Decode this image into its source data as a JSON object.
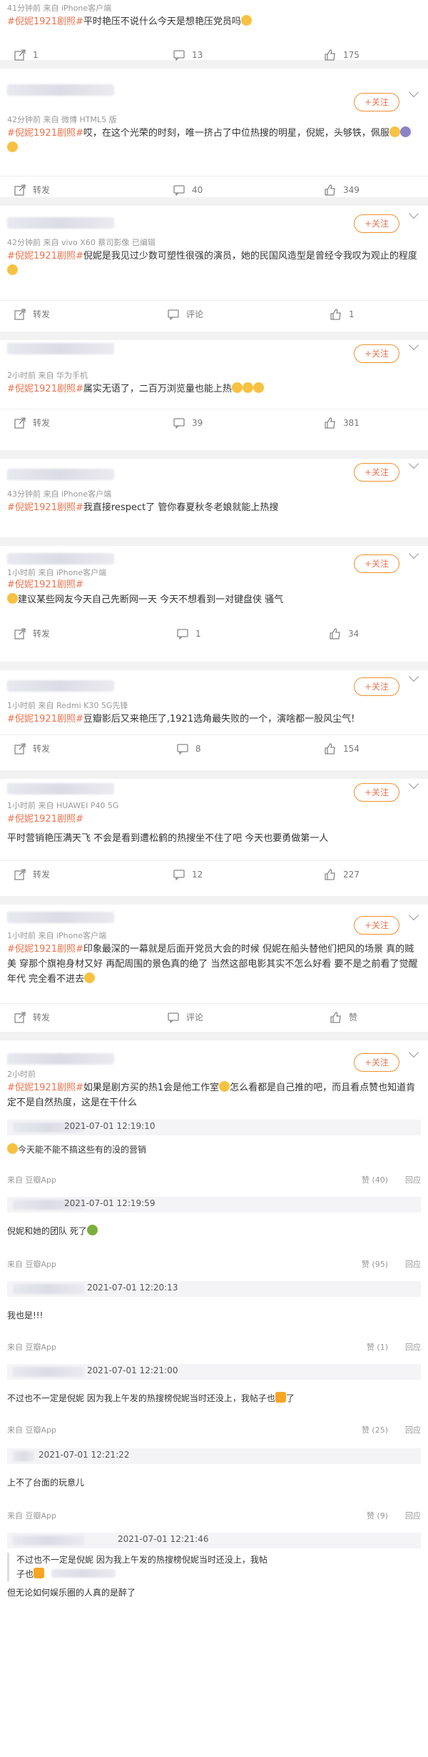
{
  "post1": {
    "meta": "41分钟前  来自 iPhone客户端",
    "tag": "#倪妮1921剧照#",
    "text": "平时艳压不说什么今天是想艳压党员吗",
    "repost": "1",
    "comments": "13",
    "likes": "175"
  },
  "post2": {
    "follow": "+关注",
    "meta": "42分钟前  来自 微博 HTML5 版",
    "tag": "#倪妮1921剧照#",
    "text": "哎，在这个光荣的时刻，唯一挤占了中位热搜的明星，倪妮，头够铁，佩服",
    "repost": "转发",
    "comments": "40",
    "likes": "349"
  },
  "post3": {
    "follow": "+关注",
    "meta": "42分钟前  来自 vivo X60 蔡司影像 已编辑",
    "tag": "#倪妮1921剧照#",
    "text": "倪妮是我见过少数可塑性很强的演员，她的民国风造型是曾经令我叹为观止的程度",
    "repost": "转发",
    "comments": "评论",
    "likes": "1"
  },
  "post4": {
    "follow": "+关注",
    "meta": "2小时前  来自 华为手机",
    "tag": "#倪妮1921剧照#",
    "text": "属实无语了，二百万浏览量也能上热",
    "repost": "转发",
    "comments": "39",
    "likes": "381"
  },
  "post5": {
    "follow": "+关注",
    "meta": "43分钟前  来自 iPhone客户端",
    "tag": "#倪妮1921剧照#",
    "text": "我直接respect了 管你春夏秋冬老娘就能上热搜"
  },
  "post6": {
    "follow": "+关注",
    "meta": "1小时前  来自 iPhone客户端",
    "tag": "#倪妮1921剧照#",
    "text": "建议某些网友今天自己先断网一天 今天不想看到一对键盘侠 骚气",
    "repost": "转发",
    "comments": "1",
    "likes": "34"
  },
  "post7": {
    "follow": "+关注",
    "meta": "1小时前  来自 Redmi K30 5G先锋",
    "tag": "#倪妮1921剧照#",
    "text": "豆瓣影后又来艳压了,1921选角最失败的一个，演啥都一股风尘气!",
    "repost": "转发",
    "comments": "8",
    "likes": "154"
  },
  "post8": {
    "follow": "+关注",
    "meta": "1小时前  来自 HUAWEI P40 5G",
    "tag": "#倪妮1921剧照#",
    "text": "平时营销艳压满天飞 不会是看到遭松鹤的热搜坐不住了吧 今天也要勇做第一人",
    "repost": "转发",
    "comments": "12",
    "likes": "227"
  },
  "post9": {
    "follow": "+关注",
    "meta": "1小时前  来自 iPhone客户端",
    "tag": "#倪妮1921剧照#",
    "text": "印象最深的一幕就是后面开党员大会的时候 倪妮在船头替他们把风的场景 真的贼美 穿那个旗袍身材又好 再配周围的景色真的绝了 当然这部电影其实不怎么好看 要不是之前看了觉醒年代 完全看不进去",
    "repost": "转发",
    "comments": "评论",
    "likes": "赞"
  },
  "post10": {
    "follow": "+关注",
    "meta": "2小时前",
    "tag": "#倪妮1921剧照#",
    "text1": "如果是剧方买的热1会是他工作室",
    "text2": "怎么看都是自己推的吧，而且看点赞也知道肯定不是自然热度，这是在干什么"
  },
  "comments": [
    {
      "time": "2021-07-01 12:19:10",
      "body": "今天能不能不搞这些有的没的营销",
      "source": "来自 豆瓣App",
      "likes": "赞 (40)",
      "reply": "回应"
    },
    {
      "time": "2021-07-01 12:19:59",
      "body": "倪妮和她的团队 死了",
      "source": "来自 豆瓣App",
      "likes": "赞 (95)",
      "reply": "回应"
    },
    {
      "time": "2021-07-01 12:20:13",
      "body": "我也是!!!",
      "source": "来自 豆瓣App",
      "likes": "赞 (1)",
      "reply": "回应"
    },
    {
      "time": "2021-07-01 12:21:00",
      "body": "不过也不一定是倪妮 因为我上午发的热搜榜倪妮当时还没上，我帖子也",
      "body2": "了",
      "source": "来自 豆瓣App",
      "likes": "赞 (25)",
      "reply": "回应"
    },
    {
      "time": "2021-07-01 12:21:22",
      "body": "上不了台面的玩意儿",
      "source": "来自 豆瓣App",
      "likes": "赞 (9)",
      "reply": "回应"
    },
    {
      "time": "2021-07-01 12:21:46",
      "quote1": "不过也不一定是倪妮 因为我上午发的热搜榜倪妮当时还没上，我帖",
      "quote2": "子也",
      "body": "但无论如何娱乐圈的人真的是醉了"
    }
  ],
  "colors": {
    "accent": "#eb7350",
    "follow_border": "#f09030",
    "meta": "#999999"
  }
}
